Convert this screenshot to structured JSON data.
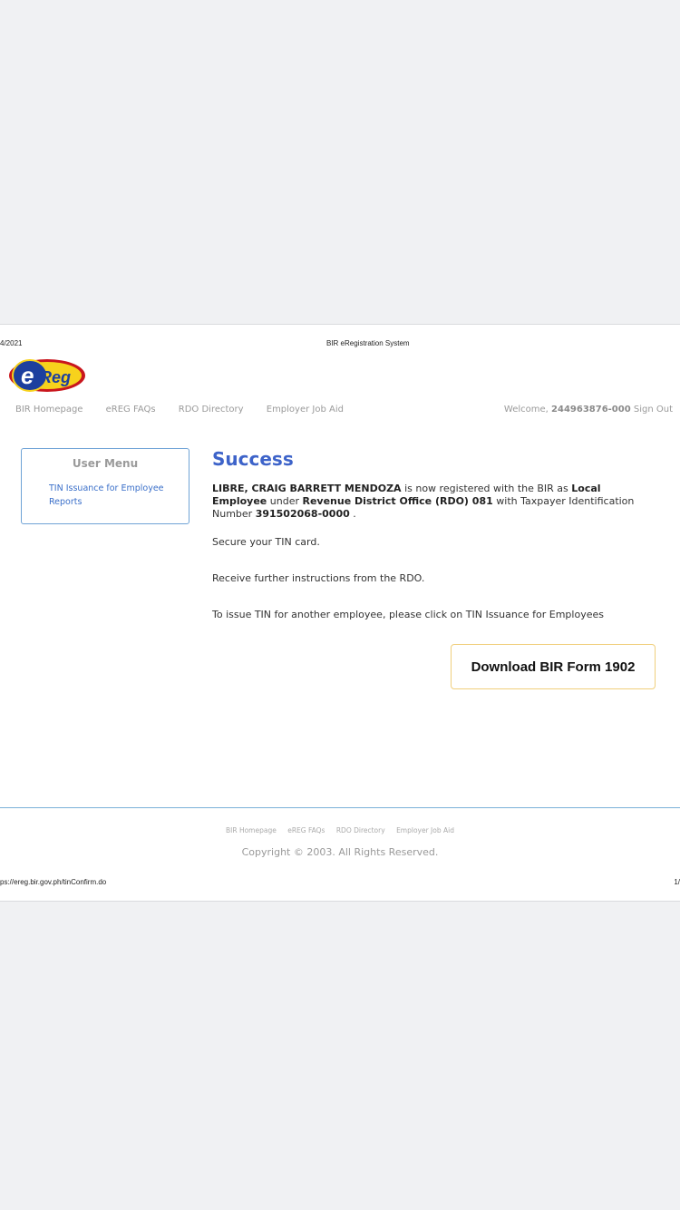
{
  "print_header": {
    "date": "4/2021",
    "title": "BIR eRegistration System"
  },
  "logo": {
    "text": "eReg"
  },
  "nav": {
    "items": [
      "BIR Homepage",
      "eREG FAQs",
      "RDO Directory",
      "Employer Job Aid"
    ],
    "welcome_prefix": "Welcome,",
    "user_id": "244963876-000",
    "sign_out": "Sign Out"
  },
  "user_menu": {
    "title": "User Menu",
    "link": "TIN Issuance for Employee Reports"
  },
  "main": {
    "heading": "Success",
    "name": "LIBRE, CRAIG BARRETT MENDOZA",
    "text1": " is now registered with the BIR as ",
    "employee_type": "Local Employee",
    "text2": " under ",
    "rdo": "Revenue District Office (RDO) 081",
    "text3": " with Taxpayer Identification Number ",
    "tin": "391502068-0000",
    "text4": " .",
    "para1": "Secure your TIN card.",
    "para2": "Receive further instructions from the RDO.",
    "para3": "To issue TIN for another employee, please click on TIN Issuance for Employees",
    "download_button": "Download BIR Form 1902"
  },
  "footer": {
    "links": [
      "BIR Homepage",
      "eREG FAQs",
      "RDO Directory",
      "Employer Job Aid"
    ],
    "copyright": "Copyright © 2003. All Rights Reserved."
  },
  "print_footer": {
    "url": "ps://ereg.bir.gov.ph/tinConfirm.do",
    "page": "1/"
  }
}
